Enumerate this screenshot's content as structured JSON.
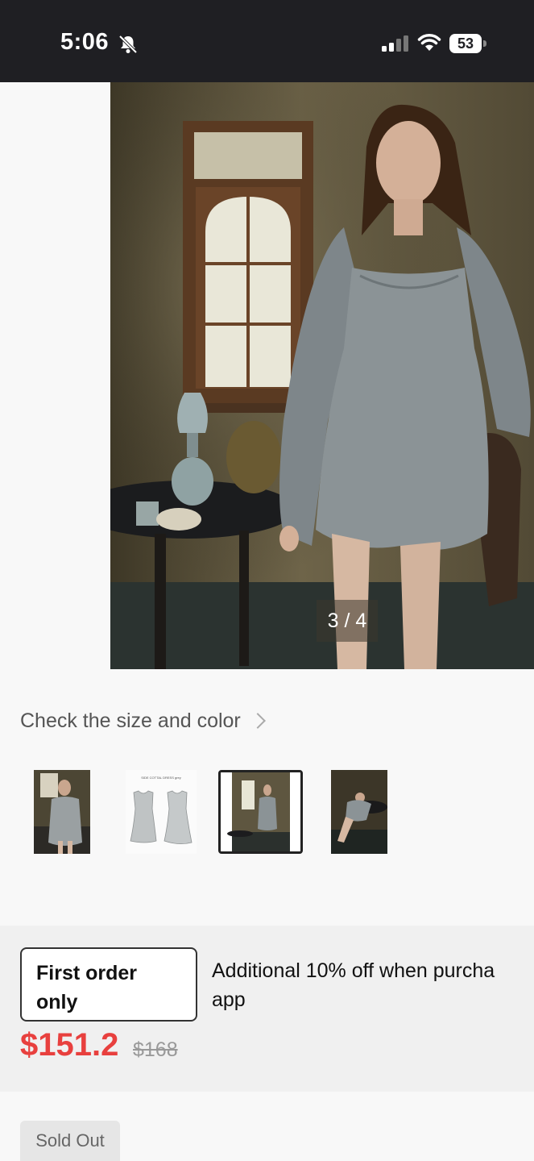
{
  "status_bar": {
    "time": "5:06",
    "battery": "53",
    "icons": [
      "bell-off-icon",
      "signal-icon",
      "wifi-icon",
      "battery-icon"
    ]
  },
  "gallery": {
    "indicator": "3 / 4"
  },
  "size_color_link": "Check the size and color",
  "thumbnails": [
    "thumbnail-1",
    "thumbnail-2",
    "thumbnail-3",
    "thumbnail-4"
  ],
  "thumbnail_caption": "SIDE COTTAL DRESS grey",
  "promo": {
    "badge_line1": "First order",
    "badge_line2": "only",
    "text_line1": "Additional 10% off when purcha",
    "text_line2": "app"
  },
  "price": {
    "current": "$151.2",
    "original": "$168",
    "accent_color": "#e8403e"
  },
  "sold_out": "Sold Out"
}
